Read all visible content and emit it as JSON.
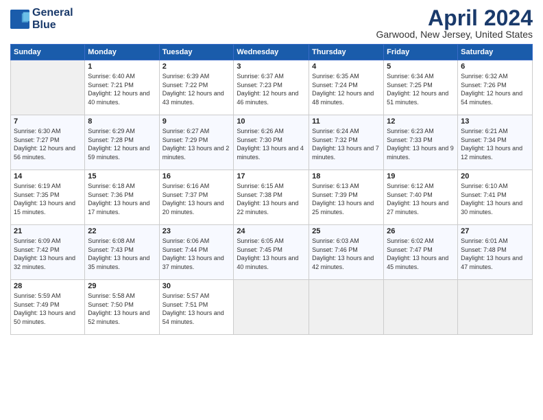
{
  "logo": {
    "line1": "General",
    "line2": "Blue"
  },
  "title": "April 2024",
  "location": "Garwood, New Jersey, United States",
  "days_header": [
    "Sunday",
    "Monday",
    "Tuesday",
    "Wednesday",
    "Thursday",
    "Friday",
    "Saturday"
  ],
  "weeks": [
    [
      {
        "day": "",
        "sunrise": "",
        "sunset": "",
        "daylight": ""
      },
      {
        "day": "1",
        "sunrise": "Sunrise: 6:40 AM",
        "sunset": "Sunset: 7:21 PM",
        "daylight": "Daylight: 12 hours and 40 minutes."
      },
      {
        "day": "2",
        "sunrise": "Sunrise: 6:39 AM",
        "sunset": "Sunset: 7:22 PM",
        "daylight": "Daylight: 12 hours and 43 minutes."
      },
      {
        "day": "3",
        "sunrise": "Sunrise: 6:37 AM",
        "sunset": "Sunset: 7:23 PM",
        "daylight": "Daylight: 12 hours and 46 minutes."
      },
      {
        "day": "4",
        "sunrise": "Sunrise: 6:35 AM",
        "sunset": "Sunset: 7:24 PM",
        "daylight": "Daylight: 12 hours and 48 minutes."
      },
      {
        "day": "5",
        "sunrise": "Sunrise: 6:34 AM",
        "sunset": "Sunset: 7:25 PM",
        "daylight": "Daylight: 12 hours and 51 minutes."
      },
      {
        "day": "6",
        "sunrise": "Sunrise: 6:32 AM",
        "sunset": "Sunset: 7:26 PM",
        "daylight": "Daylight: 12 hours and 54 minutes."
      }
    ],
    [
      {
        "day": "7",
        "sunrise": "Sunrise: 6:30 AM",
        "sunset": "Sunset: 7:27 PM",
        "daylight": "Daylight: 12 hours and 56 minutes."
      },
      {
        "day": "8",
        "sunrise": "Sunrise: 6:29 AM",
        "sunset": "Sunset: 7:28 PM",
        "daylight": "Daylight: 12 hours and 59 minutes."
      },
      {
        "day": "9",
        "sunrise": "Sunrise: 6:27 AM",
        "sunset": "Sunset: 7:29 PM",
        "daylight": "Daylight: 13 hours and 2 minutes."
      },
      {
        "day": "10",
        "sunrise": "Sunrise: 6:26 AM",
        "sunset": "Sunset: 7:30 PM",
        "daylight": "Daylight: 13 hours and 4 minutes."
      },
      {
        "day": "11",
        "sunrise": "Sunrise: 6:24 AM",
        "sunset": "Sunset: 7:32 PM",
        "daylight": "Daylight: 13 hours and 7 minutes."
      },
      {
        "day": "12",
        "sunrise": "Sunrise: 6:23 AM",
        "sunset": "Sunset: 7:33 PM",
        "daylight": "Daylight: 13 hours and 9 minutes."
      },
      {
        "day": "13",
        "sunrise": "Sunrise: 6:21 AM",
        "sunset": "Sunset: 7:34 PM",
        "daylight": "Daylight: 13 hours and 12 minutes."
      }
    ],
    [
      {
        "day": "14",
        "sunrise": "Sunrise: 6:19 AM",
        "sunset": "Sunset: 7:35 PM",
        "daylight": "Daylight: 13 hours and 15 minutes."
      },
      {
        "day": "15",
        "sunrise": "Sunrise: 6:18 AM",
        "sunset": "Sunset: 7:36 PM",
        "daylight": "Daylight: 13 hours and 17 minutes."
      },
      {
        "day": "16",
        "sunrise": "Sunrise: 6:16 AM",
        "sunset": "Sunset: 7:37 PM",
        "daylight": "Daylight: 13 hours and 20 minutes."
      },
      {
        "day": "17",
        "sunrise": "Sunrise: 6:15 AM",
        "sunset": "Sunset: 7:38 PM",
        "daylight": "Daylight: 13 hours and 22 minutes."
      },
      {
        "day": "18",
        "sunrise": "Sunrise: 6:13 AM",
        "sunset": "Sunset: 7:39 PM",
        "daylight": "Daylight: 13 hours and 25 minutes."
      },
      {
        "day": "19",
        "sunrise": "Sunrise: 6:12 AM",
        "sunset": "Sunset: 7:40 PM",
        "daylight": "Daylight: 13 hours and 27 minutes."
      },
      {
        "day": "20",
        "sunrise": "Sunrise: 6:10 AM",
        "sunset": "Sunset: 7:41 PM",
        "daylight": "Daylight: 13 hours and 30 minutes."
      }
    ],
    [
      {
        "day": "21",
        "sunrise": "Sunrise: 6:09 AM",
        "sunset": "Sunset: 7:42 PM",
        "daylight": "Daylight: 13 hours and 32 minutes."
      },
      {
        "day": "22",
        "sunrise": "Sunrise: 6:08 AM",
        "sunset": "Sunset: 7:43 PM",
        "daylight": "Daylight: 13 hours and 35 minutes."
      },
      {
        "day": "23",
        "sunrise": "Sunrise: 6:06 AM",
        "sunset": "Sunset: 7:44 PM",
        "daylight": "Daylight: 13 hours and 37 minutes."
      },
      {
        "day": "24",
        "sunrise": "Sunrise: 6:05 AM",
        "sunset": "Sunset: 7:45 PM",
        "daylight": "Daylight: 13 hours and 40 minutes."
      },
      {
        "day": "25",
        "sunrise": "Sunrise: 6:03 AM",
        "sunset": "Sunset: 7:46 PM",
        "daylight": "Daylight: 13 hours and 42 minutes."
      },
      {
        "day": "26",
        "sunrise": "Sunrise: 6:02 AM",
        "sunset": "Sunset: 7:47 PM",
        "daylight": "Daylight: 13 hours and 45 minutes."
      },
      {
        "day": "27",
        "sunrise": "Sunrise: 6:01 AM",
        "sunset": "Sunset: 7:48 PM",
        "daylight": "Daylight: 13 hours and 47 minutes."
      }
    ],
    [
      {
        "day": "28",
        "sunrise": "Sunrise: 5:59 AM",
        "sunset": "Sunset: 7:49 PM",
        "daylight": "Daylight: 13 hours and 50 minutes."
      },
      {
        "day": "29",
        "sunrise": "Sunrise: 5:58 AM",
        "sunset": "Sunset: 7:50 PM",
        "daylight": "Daylight: 13 hours and 52 minutes."
      },
      {
        "day": "30",
        "sunrise": "Sunrise: 5:57 AM",
        "sunset": "Sunset: 7:51 PM",
        "daylight": "Daylight: 13 hours and 54 minutes."
      },
      {
        "day": "",
        "sunrise": "",
        "sunset": "",
        "daylight": ""
      },
      {
        "day": "",
        "sunrise": "",
        "sunset": "",
        "daylight": ""
      },
      {
        "day": "",
        "sunrise": "",
        "sunset": "",
        "daylight": ""
      },
      {
        "day": "",
        "sunrise": "",
        "sunset": "",
        "daylight": ""
      }
    ]
  ]
}
